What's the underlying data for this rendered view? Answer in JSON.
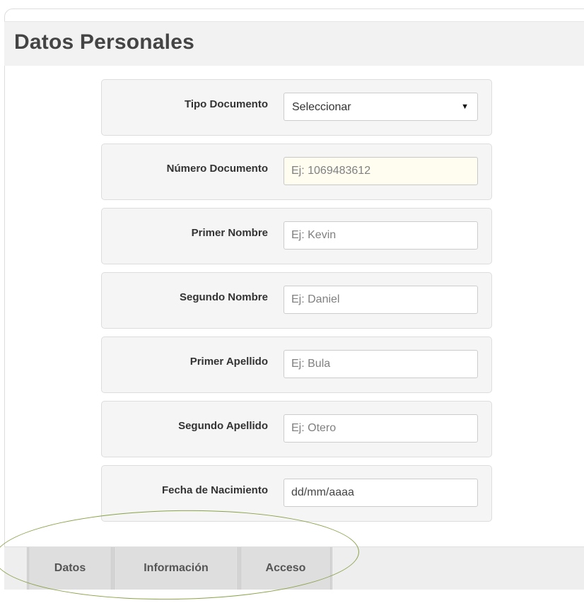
{
  "header": {
    "title": "Datos Personales"
  },
  "form": {
    "fields": [
      {
        "label": "Tipo Documento",
        "type": "select",
        "value": "Seleccionar"
      },
      {
        "label": "Número Documento",
        "type": "text",
        "placeholder": "Ej: 1069483612"
      },
      {
        "label": "Primer Nombre",
        "type": "text",
        "placeholder": "Ej: Kevin"
      },
      {
        "label": "Segundo Nombre",
        "type": "text",
        "placeholder": "Ej: Daniel"
      },
      {
        "label": "Primer Apellido",
        "type": "text",
        "placeholder": "Ej: Bula"
      },
      {
        "label": "Segundo Apellido",
        "type": "text",
        "placeholder": "Ej: Otero"
      },
      {
        "label": "Fecha de Nacimiento",
        "type": "date",
        "value": "dd/mm/aaaa"
      }
    ]
  },
  "tabs": [
    {
      "label": "Datos"
    },
    {
      "label": "Información"
    },
    {
      "label": "Acceso"
    }
  ],
  "icons": {
    "select_caret": "caret-down-icon",
    "caret_glyph": "▼"
  },
  "colors": {
    "annotation_oval": "#8aa24a",
    "focused_input_bg": "#fffdf0"
  }
}
